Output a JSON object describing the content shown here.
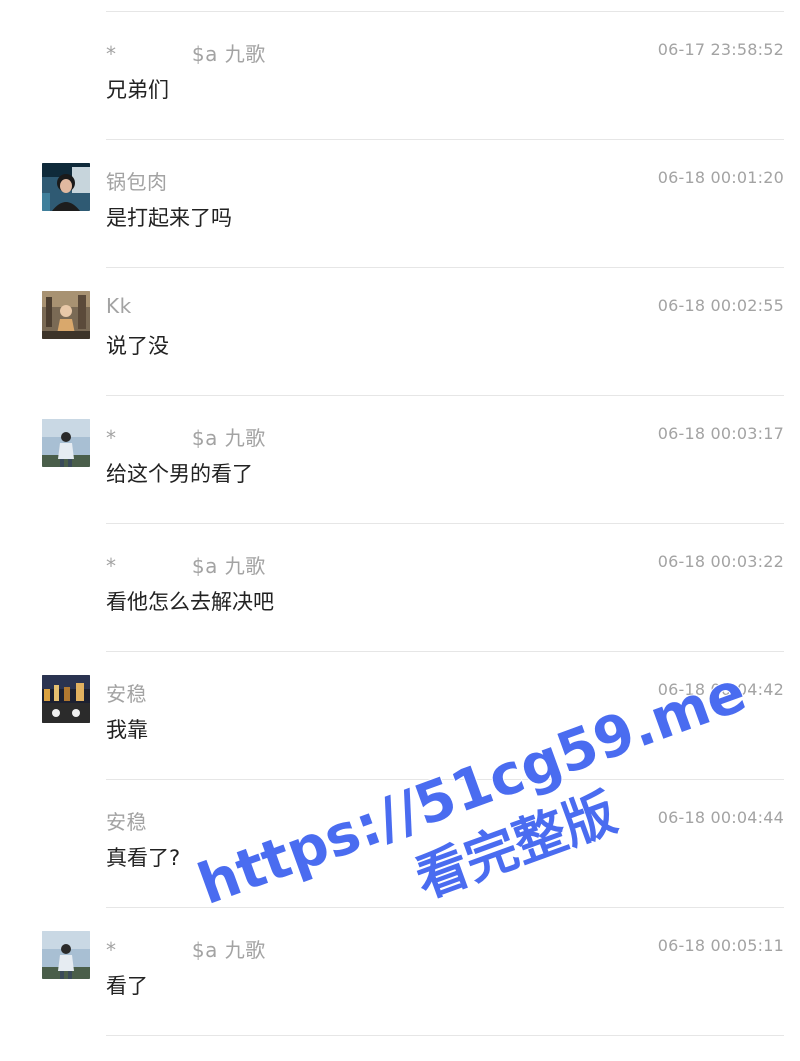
{
  "messages": [
    {
      "name": "*           $a 九歌",
      "time": "06-17 23:58:52",
      "text": "兄弟们",
      "avatar": "none"
    },
    {
      "name": "锅包肉",
      "time": "06-18 00:01:20",
      "text": "是打起来了吗",
      "avatar": "photo-portrait-icon"
    },
    {
      "name": "Kk",
      "time": "06-18 00:02:55",
      "text": "说了没",
      "avatar": "photo-street-icon"
    },
    {
      "name": "*           $a 九歌",
      "time": "06-18 00:03:17",
      "text": "给这个男的看了",
      "avatar": "photo-person-sky-icon"
    },
    {
      "name": "*           $a 九歌",
      "time": "06-18 00:03:22",
      "text": "看他怎么去解决吧",
      "avatar": "none"
    },
    {
      "name": "安稳",
      "time": "06-18 00:04:42",
      "text": "我靠",
      "avatar": "photo-night-city-icon"
    },
    {
      "name": "安稳",
      "time": "06-18 00:04:44",
      "text": "真看了?",
      "avatar": "none"
    },
    {
      "name": "*           $a 九歌",
      "time": "06-18 00:05:11",
      "text": "看了",
      "avatar": "photo-person-sky-icon"
    }
  ],
  "watermark": {
    "line1": "https://51cg59.me",
    "line2": "看完整版",
    "color": "#4a6cf0"
  }
}
